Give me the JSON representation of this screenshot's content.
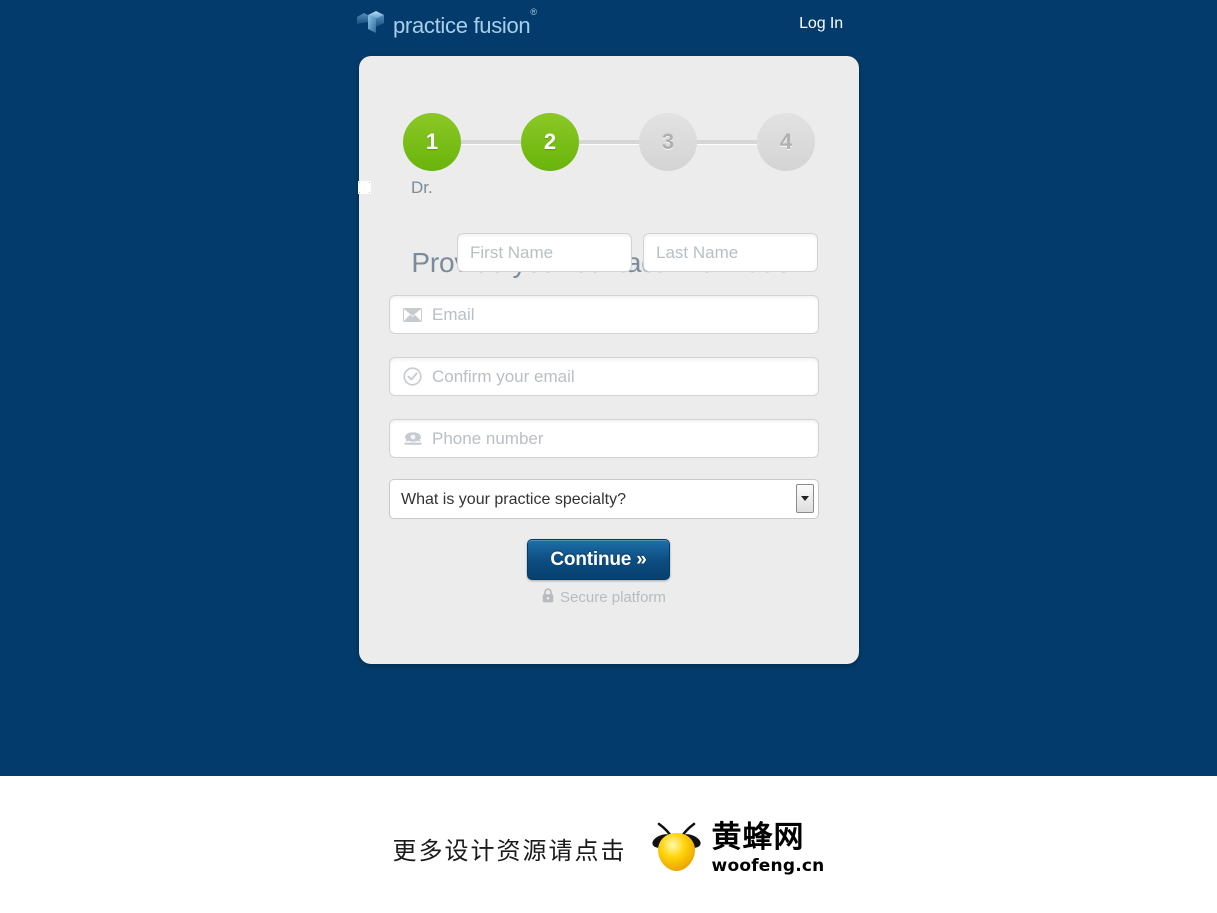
{
  "colors": {
    "hero_navy": "#033c6c",
    "card_bg": "#ececec",
    "step_active_green": "#7ec023",
    "step_inactive_gray": "#d9d9d9",
    "heading_gray": "#7b8b99",
    "button_blue": "#0d4d81",
    "placeholder_gray": "#b9bfc4"
  },
  "topbar": {
    "brand_name": "practice fusion",
    "brand_trademark": "®",
    "brand_logo_icon": "plus-cross-icon",
    "login_label": "Log In"
  },
  "card": {
    "steps": [
      {
        "number": "1",
        "state": "done"
      },
      {
        "number": "2",
        "state": "done"
      },
      {
        "number": "3",
        "state": "todo"
      },
      {
        "number": "4",
        "state": "todo"
      }
    ],
    "heading": "Provide your contact information",
    "form": {
      "dr_checkbox_label": "Dr.",
      "dr_checkbox_checked": false,
      "first_name": {
        "value": "",
        "placeholder": "First Name"
      },
      "last_name": {
        "value": "",
        "placeholder": "Last Name"
      },
      "email": {
        "value": "",
        "placeholder": "Email",
        "icon": "envelope-icon"
      },
      "confirm_email": {
        "value": "",
        "placeholder": "Confirm your email",
        "icon": "check-circle-icon"
      },
      "phone": {
        "value": "",
        "placeholder": "Phone number",
        "icon": "telephone-icon"
      },
      "specialty": {
        "selected": "What is your practice specialty?",
        "options": [
          "What is your practice specialty?"
        ]
      },
      "submit_label": "Continue »",
      "secure_label": "Secure platform",
      "secure_icon": "lock-icon"
    }
  },
  "footer": {
    "watermark_text": "更多设计资源请点击",
    "watermark_brand_cn": "黄蜂网",
    "watermark_brand_url": "woofeng.cn",
    "watermark_logo_icon": "bee-icon"
  }
}
